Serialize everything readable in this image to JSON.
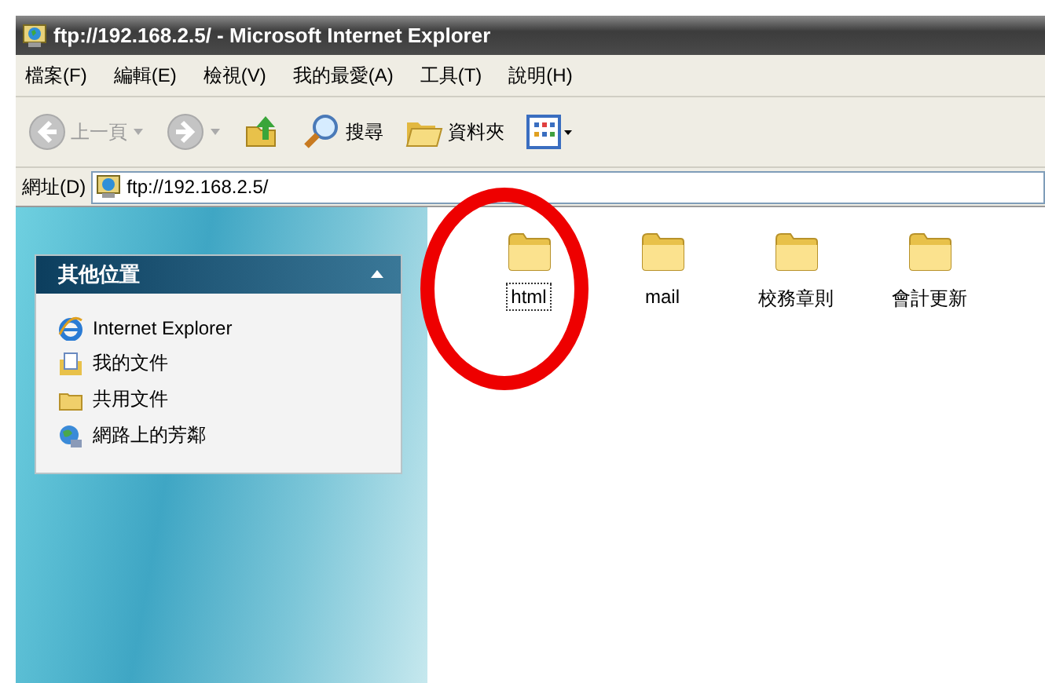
{
  "window": {
    "title": "ftp://192.168.2.5/ - Microsoft Internet Explorer"
  },
  "menu": [
    "檔案(F)",
    "編輯(E)",
    "檢視(V)",
    "我的最愛(A)",
    "工具(T)",
    "說明(H)"
  ],
  "toolbar": [
    {
      "kind": "back",
      "label": "上一頁",
      "disabled": true
    },
    {
      "kind": "forward",
      "disabled": true
    },
    {
      "kind": "up"
    },
    {
      "kind": "search",
      "label": "搜尋"
    },
    {
      "kind": "folders",
      "label": "資料夾"
    },
    {
      "kind": "views"
    }
  ],
  "address": {
    "label": "網址(D)",
    "value": "ftp://192.168.2.5/"
  },
  "sidebar": {
    "title": "其他位置",
    "expanded": true,
    "items": [
      {
        "kind": "ie",
        "label": "Internet Explorer"
      },
      {
        "kind": "docs",
        "label": "我的文件"
      },
      {
        "kind": "folder",
        "label": "共用文件"
      },
      {
        "kind": "network",
        "label": "網路上的芳鄰"
      }
    ]
  },
  "files": [
    {
      "name": "html",
      "focused": true
    },
    {
      "name": "mail",
      "focused": false
    },
    {
      "name": "校務章則",
      "focused": false
    },
    {
      "name": "會計更新",
      "focused": false
    }
  ],
  "annotation": {
    "kind": "circle"
  }
}
